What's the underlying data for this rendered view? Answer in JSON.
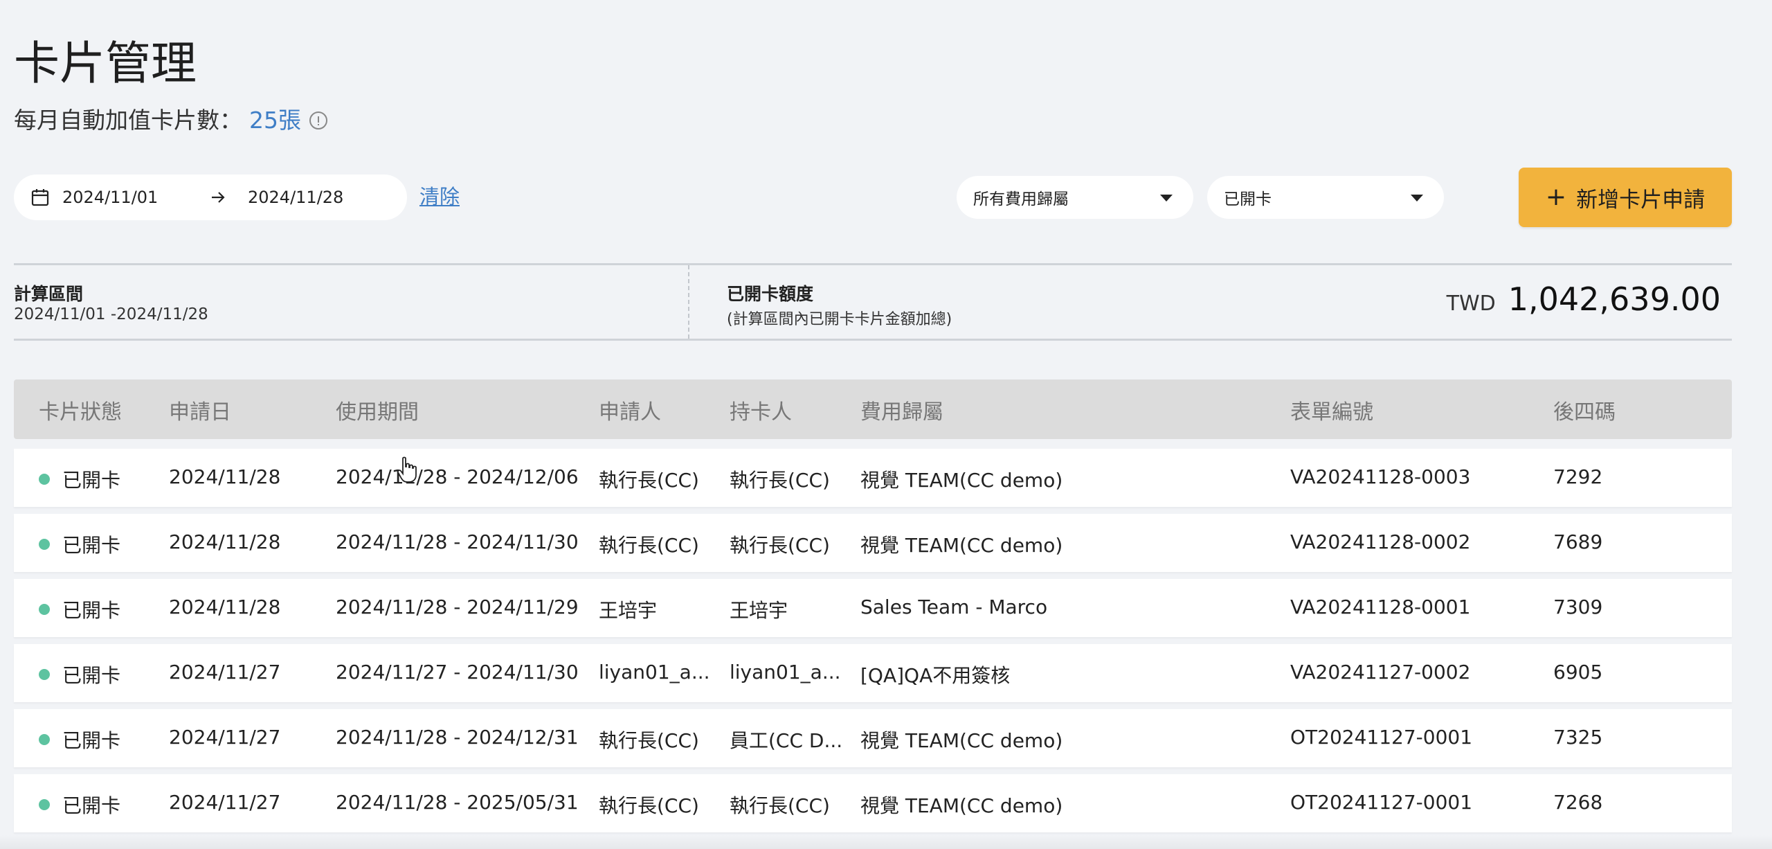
{
  "header": {
    "title": "卡片管理",
    "auto_topup_label": "每月自動加值卡片數：",
    "auto_topup_count": "25張"
  },
  "filters": {
    "date_start": "2024/11/01",
    "date_end": "2024/11/28",
    "clear_label": "清除",
    "expense_select": "所有費用歸屬",
    "status_select": "已開卡",
    "add_button_label": "新增卡片申請"
  },
  "summary": {
    "calc_label": "計算區間",
    "calc_range": "2024/11/01 -2024/11/28",
    "open_label": "已開卡額度",
    "open_note": "(計算區間內已開卡卡片金額加總)",
    "currency": "TWD",
    "amount": "1,042,639.00"
  },
  "table": {
    "columns": [
      "卡片狀態",
      "申請日",
      "使用期間",
      "申請人",
      "持卡人",
      "費用歸屬",
      "表單編號",
      "後四碼"
    ],
    "rows": [
      {
        "status": "已開卡",
        "date": "2024/11/28",
        "period": "2024/11/28 - 2024/12/06",
        "applicant": "執行長(CC)",
        "holder": "執行長(CC)",
        "expense": "視覺 TEAM(CC demo)",
        "form_no": "VA20241128-0003",
        "last4": "7292"
      },
      {
        "status": "已開卡",
        "date": "2024/11/28",
        "period": "2024/11/28 - 2024/11/30",
        "applicant": "執行長(CC)",
        "holder": "執行長(CC)",
        "expense": "視覺 TEAM(CC demo)",
        "form_no": "VA20241128-0002",
        "last4": "7689"
      },
      {
        "status": "已開卡",
        "date": "2024/11/28",
        "period": "2024/11/28 - 2024/11/29",
        "applicant": "王培宇",
        "holder": "王培宇",
        "expense": "Sales Team - Marco",
        "form_no": "VA20241128-0001",
        "last4": "7309"
      },
      {
        "status": "已開卡",
        "date": "2024/11/27",
        "period": "2024/11/27 - 2024/11/30",
        "applicant": "liyan01_a...",
        "holder": "liyan01_a...",
        "expense": "[QA]QA不用簽核",
        "form_no": "VA20241127-0002",
        "last4": "6905"
      },
      {
        "status": "已開卡",
        "date": "2024/11/27",
        "period": "2024/11/28 - 2024/12/31",
        "applicant": "執行長(CC)",
        "holder": "員工(CC D...",
        "expense": "視覺 TEAM(CC demo)",
        "form_no": "OT20241127-0001",
        "last4": "7325"
      },
      {
        "status": "已開卡",
        "date": "2024/11/27",
        "period": "2024/11/28 - 2025/05/31",
        "applicant": "執行長(CC)",
        "holder": "執行長(CC)",
        "expense": "視覺 TEAM(CC demo)",
        "form_no": "OT20241127-0001",
        "last4": "7268"
      }
    ]
  },
  "colors": {
    "accent_blue": "#3f7ec6",
    "button_yellow": "#f2b33d",
    "status_green": "#5dc3a0"
  }
}
